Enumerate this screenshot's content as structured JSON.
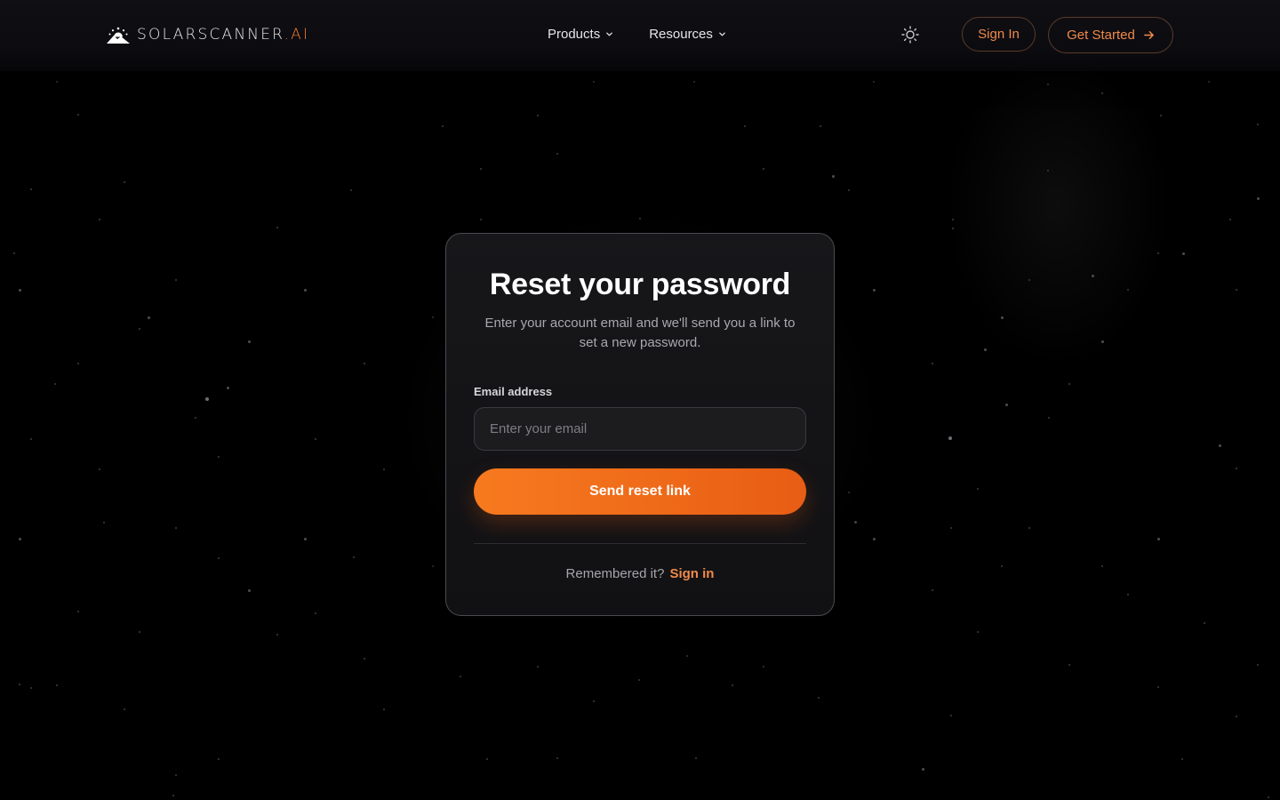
{
  "brand": {
    "name": "SOLARSCANNER",
    "suffix": ".AI",
    "accent_color": "#f07a2e",
    "icon": "sun-mountain-logo-icon"
  },
  "nav": {
    "items": [
      {
        "label": "Products",
        "icon": "chevron-down-icon"
      },
      {
        "label": "Resources",
        "icon": "chevron-down-icon"
      }
    ],
    "theme_toggle_icon": "sun-icon",
    "sign_in_label": "Sign In",
    "get_started_label": "Get Started",
    "get_started_icon": "arrow-right-icon"
  },
  "reset": {
    "title": "Reset your password",
    "subtitle": "Enter your account email and we'll send you a link to set a new password.",
    "email_label": "Email address",
    "email_placeholder": "Enter your email",
    "email_value": "",
    "submit_label": "Send reset link",
    "footer_prompt": "Remembered it?",
    "footer_link": "Sign in"
  },
  "colors": {
    "background": "#000000",
    "card": "#141416",
    "button_gradient_start": "#f77a1f",
    "button_gradient_end": "#e85d14",
    "link": "#f08a4a"
  }
}
